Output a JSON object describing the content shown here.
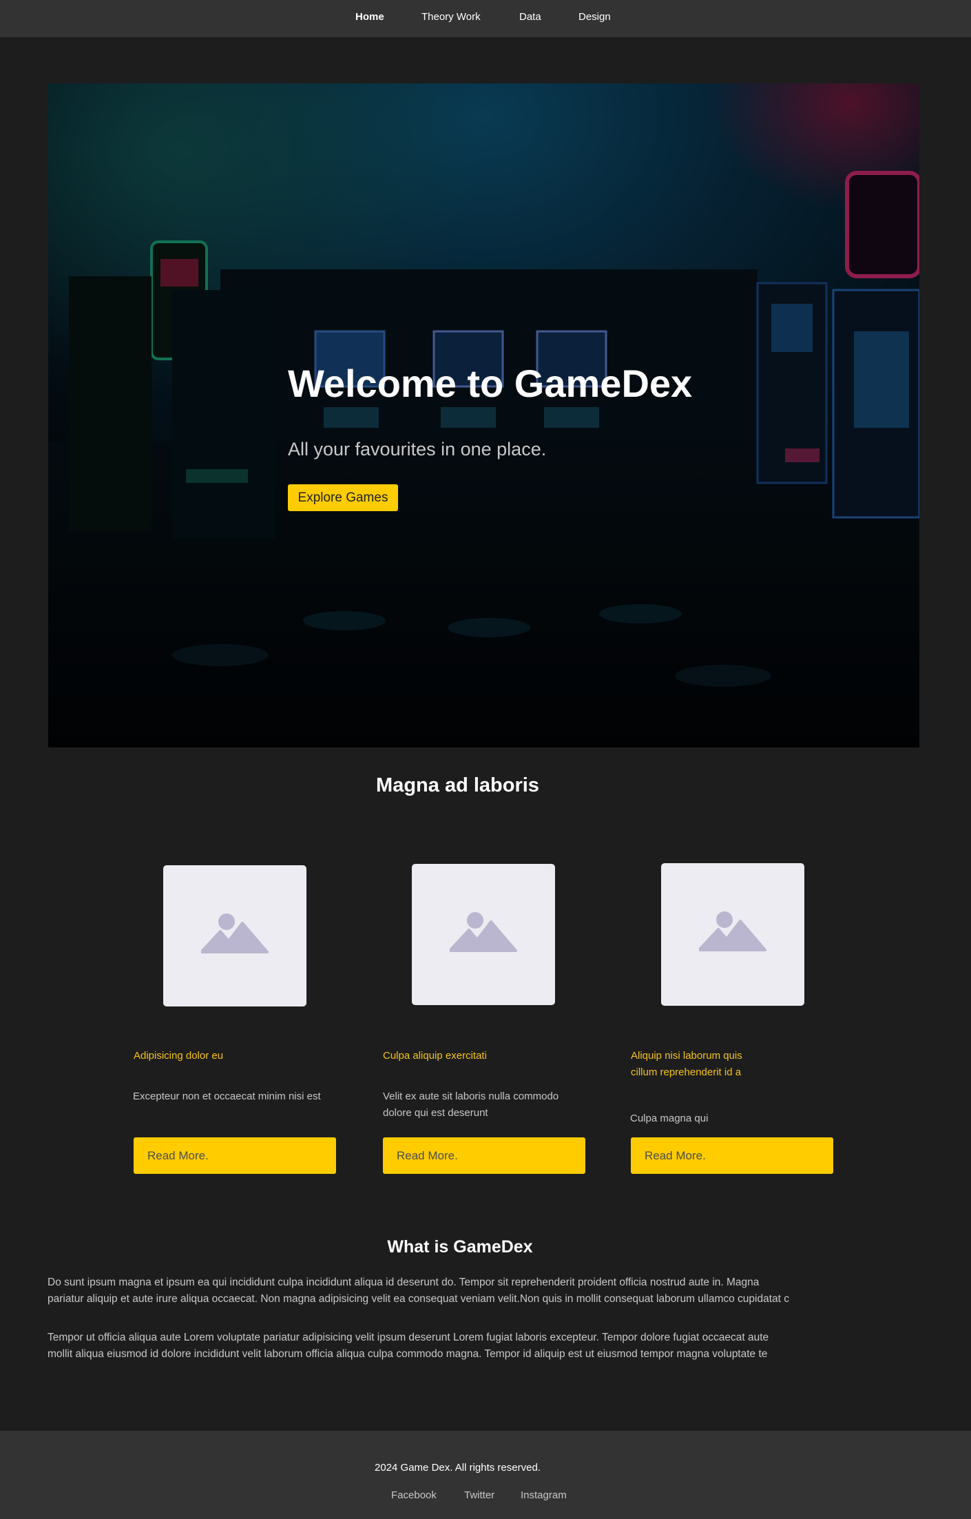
{
  "nav": {
    "items": [
      {
        "label": "Home",
        "active": true
      },
      {
        "label": "Theory Work",
        "active": false
      },
      {
        "label": "Data",
        "active": false
      },
      {
        "label": "Design",
        "active": false
      }
    ]
  },
  "hero": {
    "title": "Welcome to GameDex",
    "subtitle": "All your favourites in one place.",
    "button_label": "Explore Games"
  },
  "featured": {
    "title": "Magna ad laboris",
    "cards": [
      {
        "image_icon": "image-placeholder-icon",
        "title": "Adipisicing dolor eu",
        "text": "Excepteur non et occaecat minim nisi est",
        "button_label": "Read More."
      },
      {
        "image_icon": "image-placeholder-icon",
        "title": "Culpa aliquip exercitati",
        "text": "Velit ex aute sit laboris nulla commodo dolore qui est deserunt",
        "button_label": "Read More."
      },
      {
        "image_icon": "image-placeholder-icon",
        "title": "Aliquip nisi laborum quis cillum reprehenderit id a",
        "text": "Culpa magna qui",
        "button_label": "Read More."
      }
    ]
  },
  "about": {
    "title": "What is GameDex",
    "paragraphs": [
      {
        "line1": "Do sunt ipsum magna et ipsum ea qui incididunt culpa incididunt aliqua id deserunt do. Tempor sit reprehenderit proident officia nostrud aute in. Magna",
        "line2": "pariatur aliquip et aute irure aliqua occaecat. Non magna adipisicing velit ea consequat veniam velit.Non quis in mollit consequat laborum ullamco cupidatat c"
      },
      {
        "line1": "Tempor ut officia aliqua aute Lorem voluptate pariatur adipisicing velit ipsum deserunt Lorem fugiat laboris excepteur. Tempor dolore fugiat occaecat aute",
        "line2": "mollit aliqua eiusmod id dolore incididunt velit laborum officia aliqua culpa commodo magna. Tempor id aliquip est ut eiusmod tempor magna voluptate te"
      }
    ]
  },
  "footer": {
    "copyright": "2024 Game Dex. All rights reserved.",
    "links": [
      "Facebook",
      "Twitter",
      "Instagram"
    ]
  },
  "colors": {
    "accent": "#ffcc00",
    "card_title": "#f5c518",
    "page_background": "#1d1d1d",
    "nav_background": "#333333",
    "placeholder_background": "#edecf2",
    "placeholder_icon": "#bab6cf"
  }
}
